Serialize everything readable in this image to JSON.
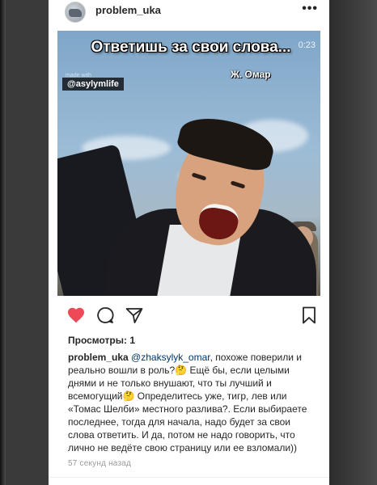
{
  "post": {
    "username": "problem_uka",
    "more_label": "•••",
    "overlay_title": "Ответишь за свои слова...",
    "video_timer": "0:23",
    "overlay_author": "Ж. Омар",
    "overlay_small_text": "made with",
    "channel_tag": "@asylymlife",
    "views_label": "Просмотры: 1",
    "caption_user": "problem_uka",
    "caption_mention": "@zhaksylyk_omar",
    "caption_text": ", похоже поверили и реально вошли в роль?🤔 Ещё бы, если целыми днями и не только внушают, что ты лучший и всемогущий🤔 Определитесь уже, тигр, лев или «Томас Шелби» местного разлива?. Если выбираете последнее, тогда для начала, надо будет за свои слова ответить. И да, потом не надо говорить, что лично не ведёте свою страницу или ее взломали))",
    "timestamp": "57 секунд назад"
  },
  "colors": {
    "like": "#ed4956",
    "text": "#262626",
    "muted": "#9a9a9a"
  },
  "icons": [
    "heart-icon",
    "comment-icon",
    "share-icon",
    "bookmark-icon",
    "more-icon"
  ]
}
